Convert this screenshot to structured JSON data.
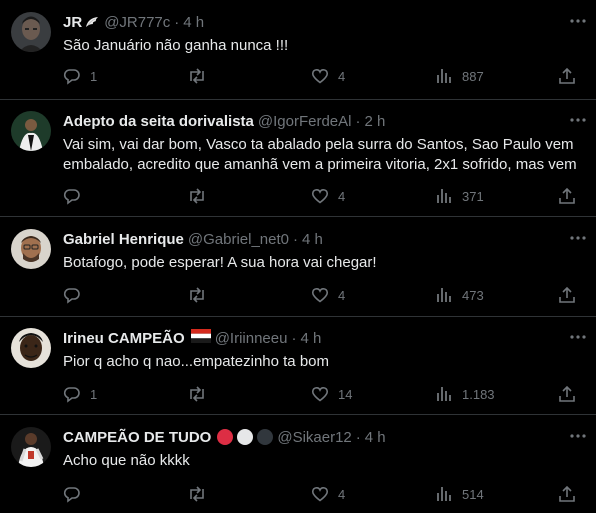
{
  "tweets": [
    {
      "name": "JR",
      "handle": "@JR777c",
      "time": "4 h",
      "text": "São Januário não ganha nunca !!!",
      "replies": "1",
      "retweets": "",
      "likes": "4",
      "views": "887"
    },
    {
      "name": "Adepto da seita dorivalista",
      "handle": "@IgorFerdeAl",
      "time": "2 h",
      "text": "Vai sim, vai dar bom, Vasco ta abalado pela surra do Santos, Sao Paulo vem embalado, acredito que amanhã vem a primeira vitoria, 2x1 sofrido, mas vem",
      "replies": "",
      "retweets": "",
      "likes": "4",
      "views": "371"
    },
    {
      "name": "Gabriel Henrique",
      "handle": "@Gabriel_net0",
      "time": "4 h",
      "text": "Botafogo, pode esperar! A sua hora vai chegar!",
      "replies": "",
      "retweets": "",
      "likes": "4",
      "views": "473"
    },
    {
      "name": "Irineu CAMPEÃO",
      "handle": "@Iriinneeu",
      "time": "4 h",
      "text": "Pior q acho q nao...empatezinho ta bom",
      "replies": "1",
      "retweets": "",
      "likes": "14",
      "views": "1.183"
    },
    {
      "name": "CAMPEÃO DE TUDO",
      "handle": "@Sikaer12",
      "time": "4 h",
      "text": "Acho que não kkkk",
      "replies": "",
      "retweets": "",
      "likes": "4",
      "views": "514"
    }
  ],
  "separator": "·",
  "colors": {
    "background": "#000000",
    "text": "#e7e9ea",
    "muted": "#71767b",
    "divider": "#2f3336"
  },
  "icons": [
    "reply-icon",
    "retweet-icon",
    "like-icon",
    "views-icon",
    "share-icon",
    "more-icon"
  ]
}
